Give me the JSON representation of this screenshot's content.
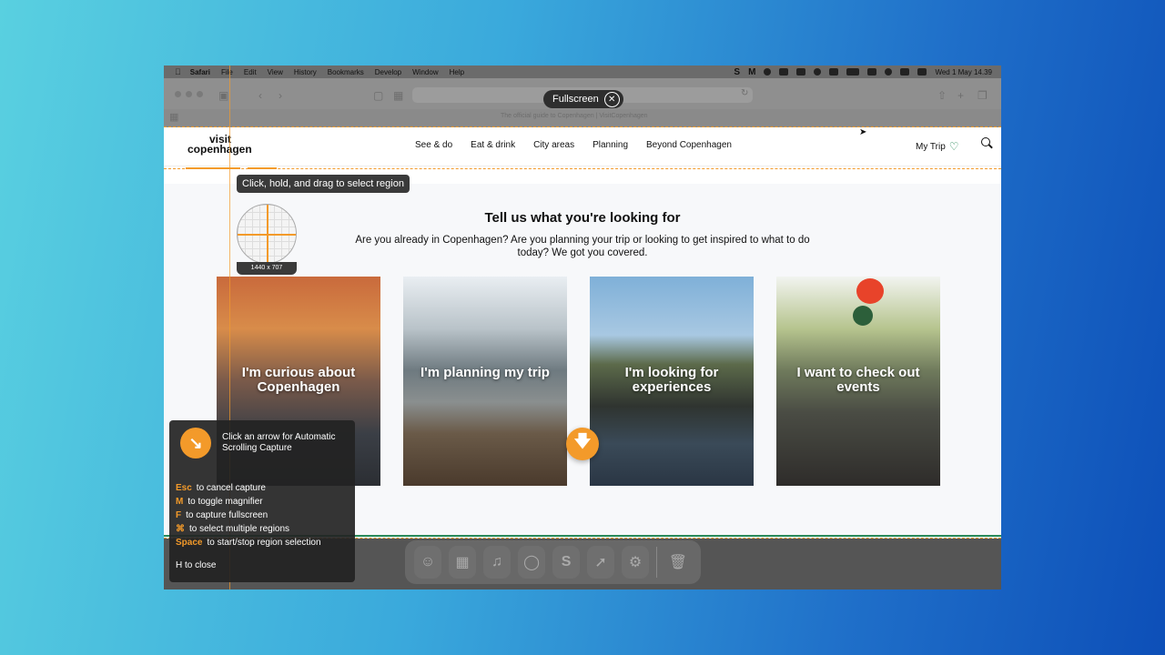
{
  "menubar": {
    "app": "Safari",
    "items": [
      "File",
      "Edit",
      "View",
      "History",
      "Bookmarks",
      "Develop",
      "Window",
      "Help"
    ],
    "status_letters": [
      "S",
      "M"
    ],
    "clock": "Wed 1 May  14.39"
  },
  "browser": {
    "tab_title": "The official guide to Copenhagen | VisitCopenhagen",
    "fullscreen_label": "Fullscreen"
  },
  "site": {
    "logo_line1": "visit",
    "logo_line2": "copenhagen",
    "nav": [
      "See & do",
      "Eat & drink",
      "City areas",
      "Planning",
      "Beyond Copenhagen"
    ],
    "my_trip": "My Trip",
    "headline": "Tell us what you're looking for",
    "subtext": "Are you already in Copenhagen? Are you planning your trip or looking to get inspired to what to do today? We got you covered.",
    "cards": [
      {
        "label": "I'm curious about Copenhagen"
      },
      {
        "label": "I'm planning my trip"
      },
      {
        "label": "I'm looking for experiences"
      },
      {
        "label": "I want to check out events"
      }
    ]
  },
  "capture": {
    "tooltip": "Click, hold, and drag to select region",
    "magnifier_size": "1440 x 707",
    "panel_title": "Click an arrow for Automatic Scrolling Capture",
    "shortcuts": [
      {
        "key": "Esc",
        "desc": "to cancel capture"
      },
      {
        "key": "M",
        "desc": "to toggle magnifier"
      },
      {
        "key": "F",
        "desc": "to capture fullscreen"
      },
      {
        "key": "⌘",
        "desc": "to select multiple regions"
      },
      {
        "key": "Space",
        "desc": "to start/stop region selection"
      }
    ],
    "close_hint": "H to close",
    "accent": "#f39a2a"
  },
  "dock": {
    "icons": [
      "finder-icon",
      "launchpad-icon",
      "music-icon",
      "chrome-icon",
      "scrolling-app-icon",
      "safari-icon",
      "settings-icon",
      "trash-icon"
    ]
  }
}
